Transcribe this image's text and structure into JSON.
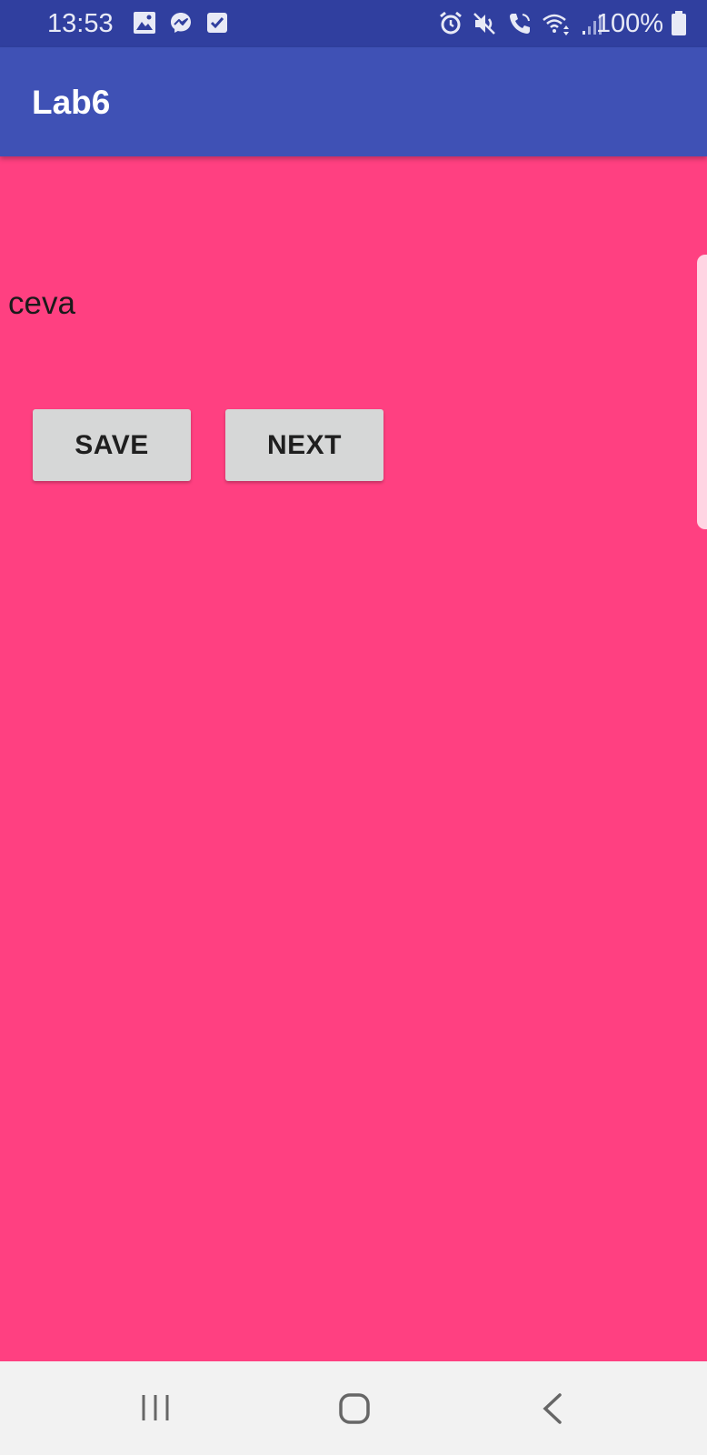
{
  "status_bar": {
    "time": "13:53",
    "battery_text": "100%",
    "background_color": "#303F9F",
    "left_icons": [
      "gallery-icon",
      "messenger-icon",
      "checkbox-notification-icon"
    ],
    "right_icons": [
      "alarm-icon",
      "mute-icon",
      "volte-call-icon",
      "wifi-icon",
      "signal-icon",
      "battery-icon"
    ]
  },
  "app_bar": {
    "title": "Lab6",
    "background_color": "#3F51B5"
  },
  "content": {
    "background_color": "#FF4081",
    "text": "ceva"
  },
  "buttons": {
    "save_label": "SAVE",
    "next_label": "NEXT"
  },
  "nav_bar": {
    "icons": [
      "recent-apps-icon",
      "home-icon",
      "back-icon"
    ]
  }
}
